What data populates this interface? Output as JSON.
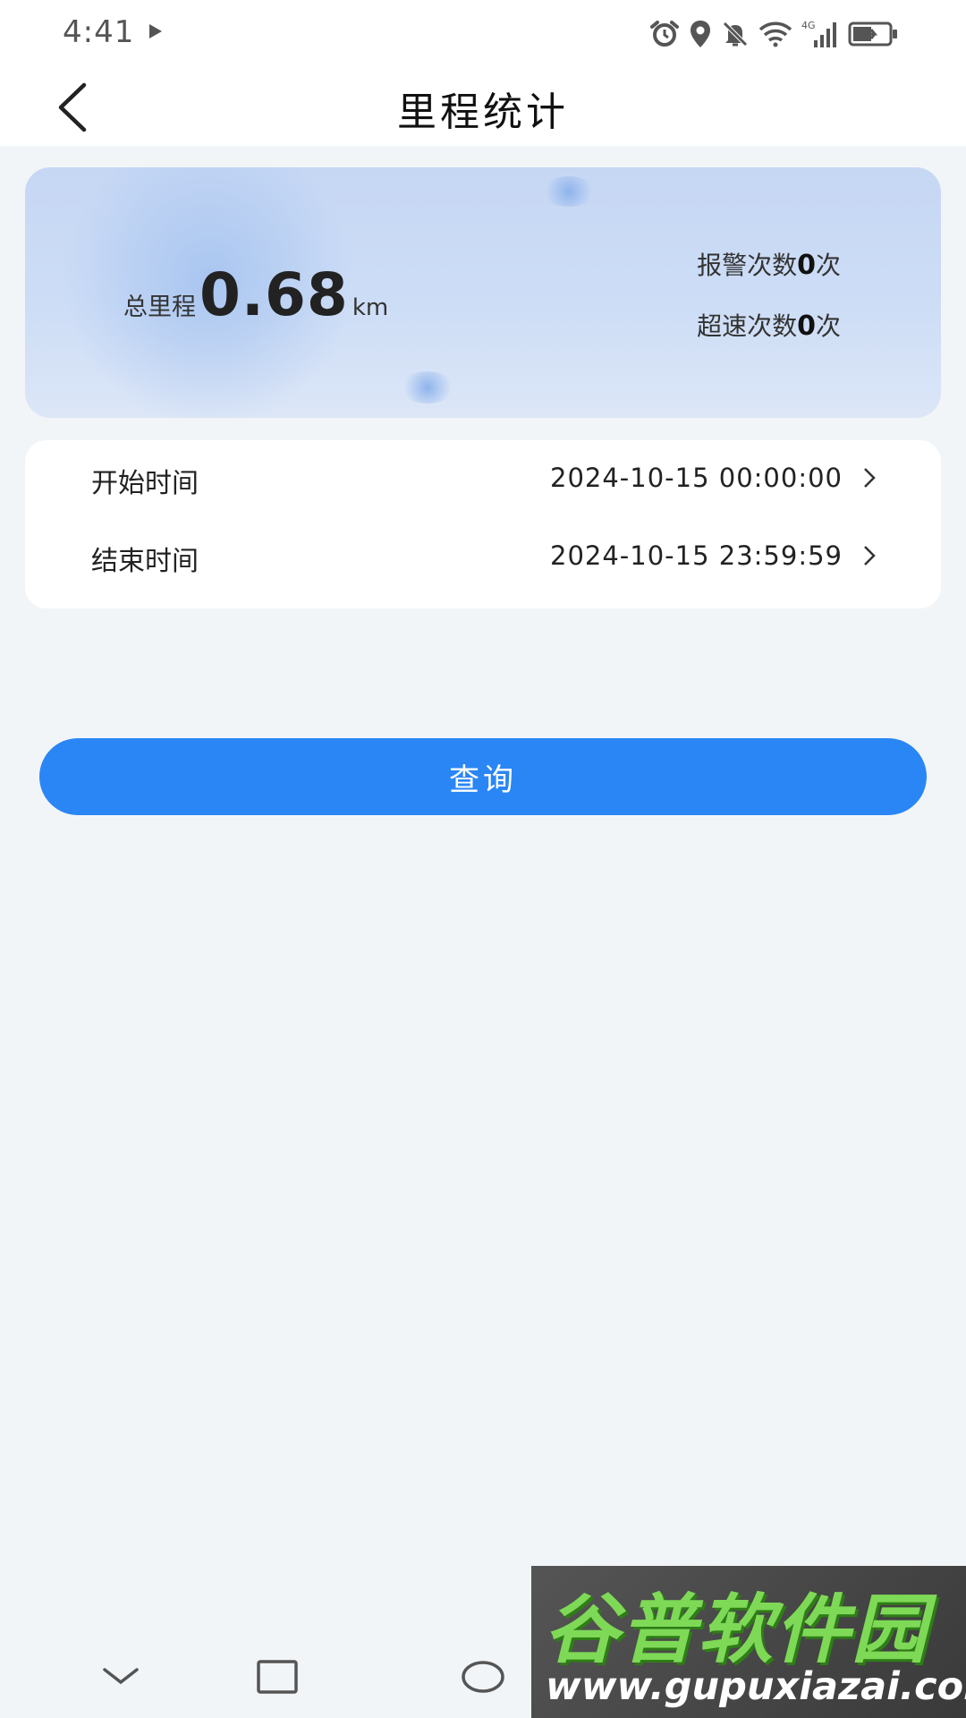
{
  "status_bar": {
    "time": "4:41",
    "icons": [
      "play-icon",
      "alarm-icon",
      "location-icon",
      "mute-icon",
      "wifi-icon",
      "signal-4g-icon",
      "battery-charging-icon"
    ],
    "network": "4G"
  },
  "header": {
    "title": "里程统计"
  },
  "summary": {
    "total_label": "总里程",
    "total_value": "0.68",
    "total_unit": "km",
    "alarm_label": "报警次数",
    "alarm_count": "0",
    "alarm_suffix": "次",
    "speeding_label": "超速次数",
    "speeding_count": "0",
    "speeding_suffix": "次"
  },
  "time_range": {
    "start_label": "开始时间",
    "start_value": "2024-10-15 00:00:00",
    "end_label": "结束时间",
    "end_value": "2024-10-15 23:59:59"
  },
  "query_button": {
    "label": "查询"
  },
  "nav_bar": {
    "icons": [
      "nav-collapse-icon",
      "nav-recents-icon",
      "nav-home-icon",
      "nav-back-icon"
    ]
  },
  "watermark": {
    "title": "谷普软件园",
    "url": "www.gupuxiazai.com"
  },
  "colors": {
    "primary": "#2a86f5",
    "background": "#f2f5f8",
    "card": "#ffffff",
    "summary_card": "#c9daf5"
  }
}
